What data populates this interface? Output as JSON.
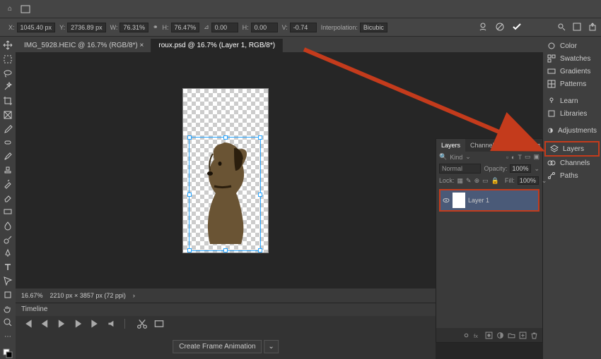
{
  "topbar": {
    "home": "⌂"
  },
  "options": {
    "x_label": "X:",
    "x": "1045.40 px",
    "y_label": "Y:",
    "y": "2736.89 px",
    "w_label": "W:",
    "w": "76.31%",
    "link": "⚭",
    "h_label": "H:",
    "h": "76.47%",
    "angle_label": "⊿",
    "angle": "0.00",
    "shear_h_label": "H:",
    "shear_h": "0.00",
    "shear_v_label": "V:",
    "shear_v": "-0.74",
    "interp_label": "Interpolation:",
    "interp": "Bicubic"
  },
  "tabs": {
    "inactive": "IMG_5928.HEIC @ 16.7% (RGB/8*) ×",
    "active": "roux.psd @ 16.7% (Layer 1, RGB/8*)"
  },
  "status": {
    "zoom": "16.67%",
    "docinfo": "2210 px × 3857 px (72 ppi)"
  },
  "timeline": {
    "title": "Timeline",
    "button": "Create Frame Animation"
  },
  "layers": {
    "tab_layers": "Layers",
    "tab_channels": "Channels",
    "tab_paths": "Paths",
    "kind": "Kind",
    "blend": "Normal",
    "opacity_label": "Opacity:",
    "opacity": "100%",
    "lock_label": "Lock:",
    "fill_label": "Fill:",
    "fill": "100%",
    "layer1": "Layer 1"
  },
  "right_panels": {
    "color": "Color",
    "swatches": "Swatches",
    "gradients": "Gradients",
    "patterns": "Patterns",
    "learn": "Learn",
    "libraries": "Libraries",
    "adjustments": "Adjustments",
    "layers": "Layers",
    "channels": "Channels",
    "paths": "Paths"
  },
  "colors": {
    "highlight": "#c43b1c",
    "selection": "#27a5ff"
  }
}
